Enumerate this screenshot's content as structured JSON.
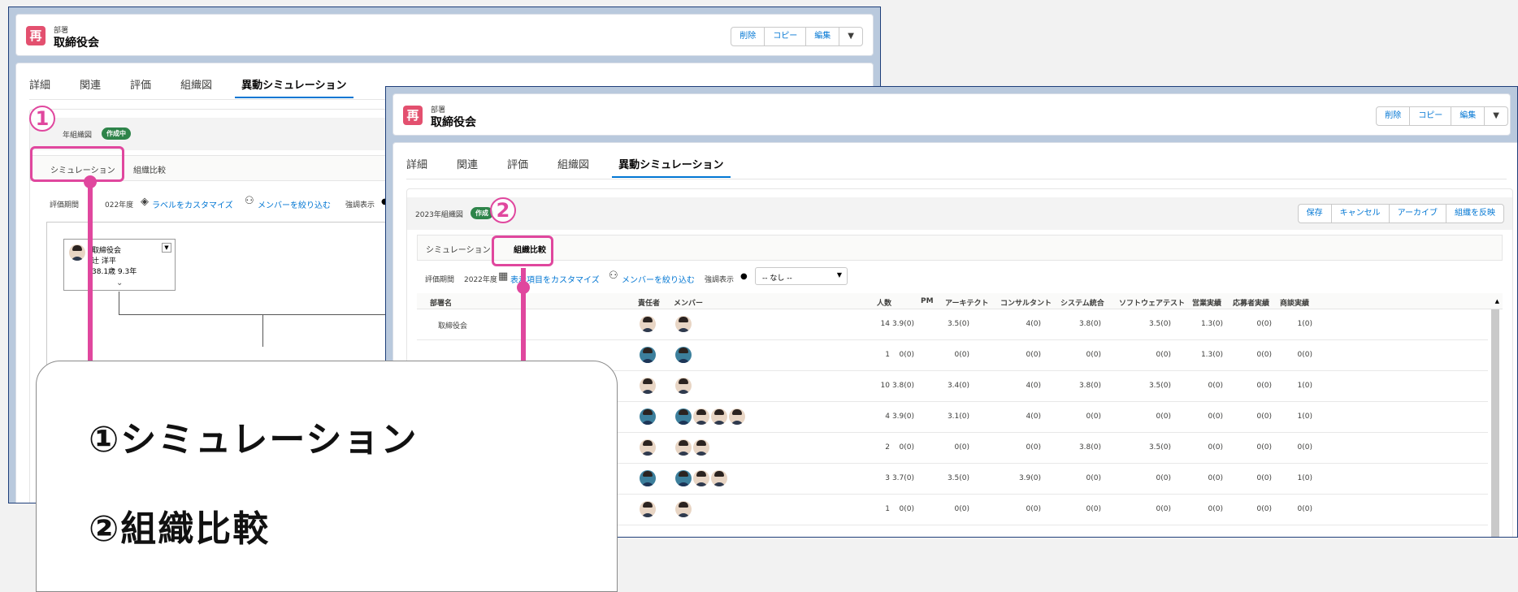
{
  "record": {
    "object_type": "部署",
    "name": "取締役会",
    "icon_glyph": "再",
    "actions": [
      "削除",
      "コピー",
      "編集"
    ]
  },
  "tabs": [
    "詳細",
    "関連",
    "評価",
    "組織図",
    "異動シミュレーション"
  ],
  "back_window": {
    "badge_prefix": "年組織図",
    "status_badge": "作成中",
    "sub_tabs": [
      "シミュレーション",
      "組織比較"
    ],
    "period_label": "評価期間",
    "period_value": "022年度",
    "customize_label_link": "ラベルをカスタマイズ",
    "filter_members_link": "メンバーを絞り込む",
    "emphasis_label": "強調表示",
    "org_card": {
      "dept": "取締役会",
      "person": "辻 洋平",
      "meta": "38.1歳 9.3年"
    }
  },
  "front_window": {
    "org_chart_name": "2023年組織図",
    "status_badge": "作成",
    "banner_actions": [
      "保存",
      "キャンセル",
      "アーカイブ",
      "組織を反映"
    ],
    "sub_tabs": [
      "シミュレーション",
      "組織比較"
    ],
    "period_label": "評価期間",
    "period_value": "2022年度",
    "customize_columns_link": "表示項目をカスタマイズ",
    "filter_members_link": "メンバーを絞り込む",
    "emphasis_label": "強調表示",
    "emphasis_select": "-- なし --",
    "columns": [
      "部署名",
      "責任者",
      "メンバー",
      "人数",
      "PM",
      "アーキテクト",
      "コンサルタント",
      "システム統合",
      "ソフトウェアテスト",
      "営業実績",
      "応募者実績",
      "商談実績"
    ],
    "rows": [
      {
        "dept": "取締役会",
        "members": 1,
        "count": "14",
        "vals": [
          "3.9(0)",
          "3.5(0)",
          "4(0)",
          "3.8(0)",
          "3.5(0)",
          "1.3(0)",
          "0(0)",
          "1(0)"
        ]
      },
      {
        "dept": "",
        "members": 1,
        "count": "1",
        "vals": [
          "0(0)",
          "0(0)",
          "0(0)",
          "0(0)",
          "0(0)",
          "1.3(0)",
          "0(0)",
          "0(0)"
        ]
      },
      {
        "dept": "",
        "members": 1,
        "count": "10",
        "vals": [
          "3.8(0)",
          "3.4(0)",
          "4(0)",
          "3.8(0)",
          "3.5(0)",
          "0(0)",
          "0(0)",
          "1(0)"
        ]
      },
      {
        "dept": "",
        "members": 4,
        "count": "4",
        "vals": [
          "3.9(0)",
          "3.1(0)",
          "4(0)",
          "0(0)",
          "0(0)",
          "0(0)",
          "0(0)",
          "1(0)"
        ]
      },
      {
        "dept": "",
        "members": 2,
        "count": "2",
        "vals": [
          "0(0)",
          "0(0)",
          "0(0)",
          "3.8(0)",
          "3.5(0)",
          "0(0)",
          "0(0)",
          "0(0)"
        ]
      },
      {
        "dept": "",
        "members": 3,
        "count": "3",
        "vals": [
          "3.7(0)",
          "3.5(0)",
          "3.9(0)",
          "0(0)",
          "0(0)",
          "0(0)",
          "0(0)",
          "1(0)"
        ]
      },
      {
        "dept": "",
        "members": 1,
        "count": "1",
        "vals": [
          "0(0)",
          "0(0)",
          "0(0)",
          "0(0)",
          "0(0)",
          "0(0)",
          "0(0)",
          "0(0)"
        ]
      }
    ]
  },
  "annotations": {
    "marker_1": "1",
    "marker_2": "2",
    "legend_1": "①シミュレーション",
    "legend_2": "②組織比較"
  },
  "colors": {
    "accent": "#e0479e",
    "brand_blue": "#0176d3",
    "status_green": "#2e844a"
  }
}
